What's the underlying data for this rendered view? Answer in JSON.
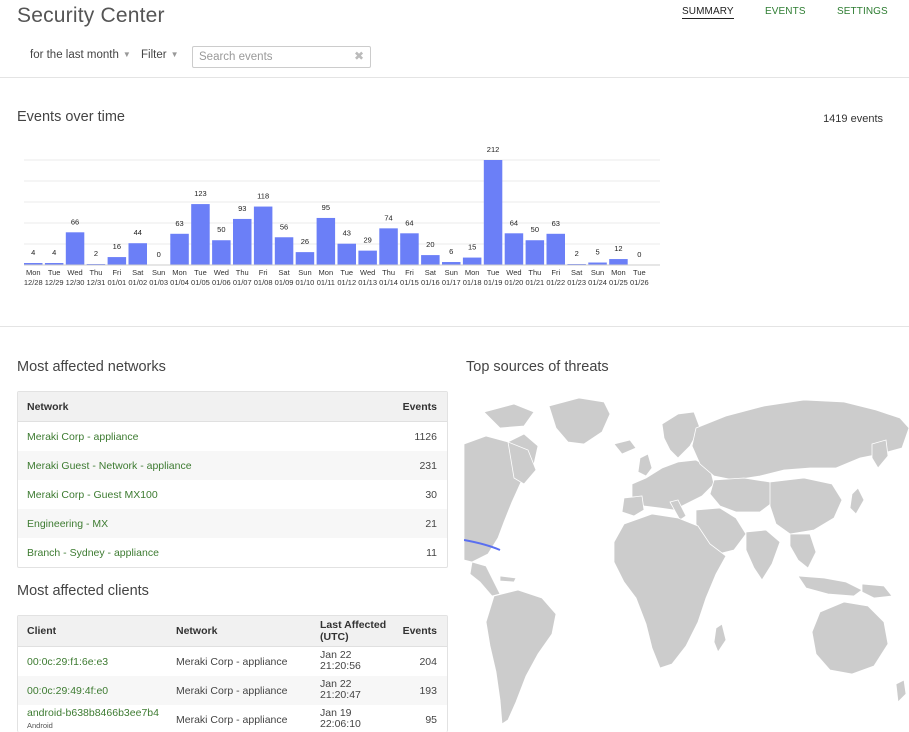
{
  "header": {
    "title": "Security Center",
    "tabs": [
      {
        "label": "SUMMARY",
        "active": true
      },
      {
        "label": "EVENTS",
        "active": false
      },
      {
        "label": "SETTINGS",
        "active": false
      }
    ]
  },
  "toolbar": {
    "time_range": "for the last month",
    "filter_label": "Filter",
    "search_placeholder": "Search events",
    "search_value": "",
    "clear_glyph": "✖"
  },
  "events_over_time": {
    "title": "Events over time",
    "total": "1419 events"
  },
  "chart_data": {
    "type": "bar",
    "categories": [
      "Mon 12/28",
      "Tue 12/29",
      "Wed 12/30",
      "Thu 12/31",
      "Fri 01/01",
      "Sat 01/02",
      "Sun 01/03",
      "Mon 01/04",
      "Tue 01/05",
      "Wed 01/06",
      "Thu 01/07",
      "Fri 01/08",
      "Sat 01/09",
      "Sun 01/10",
      "Mon 01/11",
      "Tue 01/12",
      "Wed 01/13",
      "Thu 01/14",
      "Fri 01/15",
      "Sat 01/16",
      "Sun 01/17",
      "Mon 01/18",
      "Tue 01/19",
      "Wed 01/20",
      "Thu 01/21",
      "Fri 01/22",
      "Sat 01/23",
      "Sun 01/24",
      "Mon 01/25",
      "Tue 01/26"
    ],
    "day_labels": [
      "Mon",
      "Tue",
      "Wed",
      "Thu",
      "Fri",
      "Sat",
      "Sun",
      "Mon",
      "Tue",
      "Wed",
      "Thu",
      "Fri",
      "Sat",
      "Sun",
      "Mon",
      "Tue",
      "Wed",
      "Thu",
      "Fri",
      "Sat",
      "Sun",
      "Mon",
      "Tue",
      "Wed",
      "Thu",
      "Fri",
      "Sat",
      "Sun",
      "Mon",
      "Tue"
    ],
    "date_labels": [
      "12/28",
      "12/29",
      "12/30",
      "12/31",
      "01/01",
      "01/02",
      "01/03",
      "01/04",
      "01/05",
      "01/06",
      "01/07",
      "01/08",
      "01/09",
      "01/10",
      "01/11",
      "01/12",
      "01/13",
      "01/14",
      "01/15",
      "01/16",
      "01/17",
      "01/18",
      "01/19",
      "01/20",
      "01/21",
      "01/22",
      "01/23",
      "01/24",
      "01/25",
      "01/26"
    ],
    "values": [
      4,
      4,
      66,
      2,
      16,
      44,
      0,
      63,
      123,
      50,
      93,
      118,
      56,
      26,
      95,
      43,
      29,
      74,
      64,
      20,
      6,
      15,
      212,
      64,
      50,
      63,
      2,
      5,
      12,
      0
    ],
    "ylim": [
      0,
      212
    ],
    "bar_color": "#6b7ff7",
    "grid": true
  },
  "networks": {
    "title": "Most affected networks",
    "columns": [
      "Network",
      "Events"
    ],
    "rows": [
      {
        "name": "Meraki Corp - appliance",
        "events": "1126"
      },
      {
        "name": "Meraki Guest - Network - appliance",
        "events": "231"
      },
      {
        "name": "Meraki Corp - Guest MX100",
        "events": "30"
      },
      {
        "name": "Engineering - MX",
        "events": "21"
      },
      {
        "name": "Branch - Sydney - appliance",
        "events": "11"
      }
    ]
  },
  "clients": {
    "title": "Most affected clients",
    "columns": [
      "Client",
      "Network",
      "Last Affected (UTC)",
      "Events"
    ],
    "rows": [
      {
        "client": "00:0c:29:f1:6e:e3",
        "sub": "",
        "network": "Meraki Corp - appliance",
        "date": "Jan 22",
        "time": "21:20:56",
        "events": "204"
      },
      {
        "client": "00:0c:29:49:4f:e0",
        "sub": "",
        "network": "Meraki Corp - appliance",
        "date": "Jan 22",
        "time": "21:20:47",
        "events": "193"
      },
      {
        "client": "android-b638b8466b3ee7b4",
        "sub": "Android",
        "network": "Meraki Corp - appliance",
        "date": "Jan 19",
        "time": "22:06:10",
        "events": "95"
      }
    ]
  },
  "threats": {
    "title": "Top sources of threats",
    "land_color": "#cccccc",
    "arc_color": "#5a6ff0"
  },
  "colors": {
    "accent_link": "#3d7b31",
    "bar": "#6b7ff7"
  }
}
